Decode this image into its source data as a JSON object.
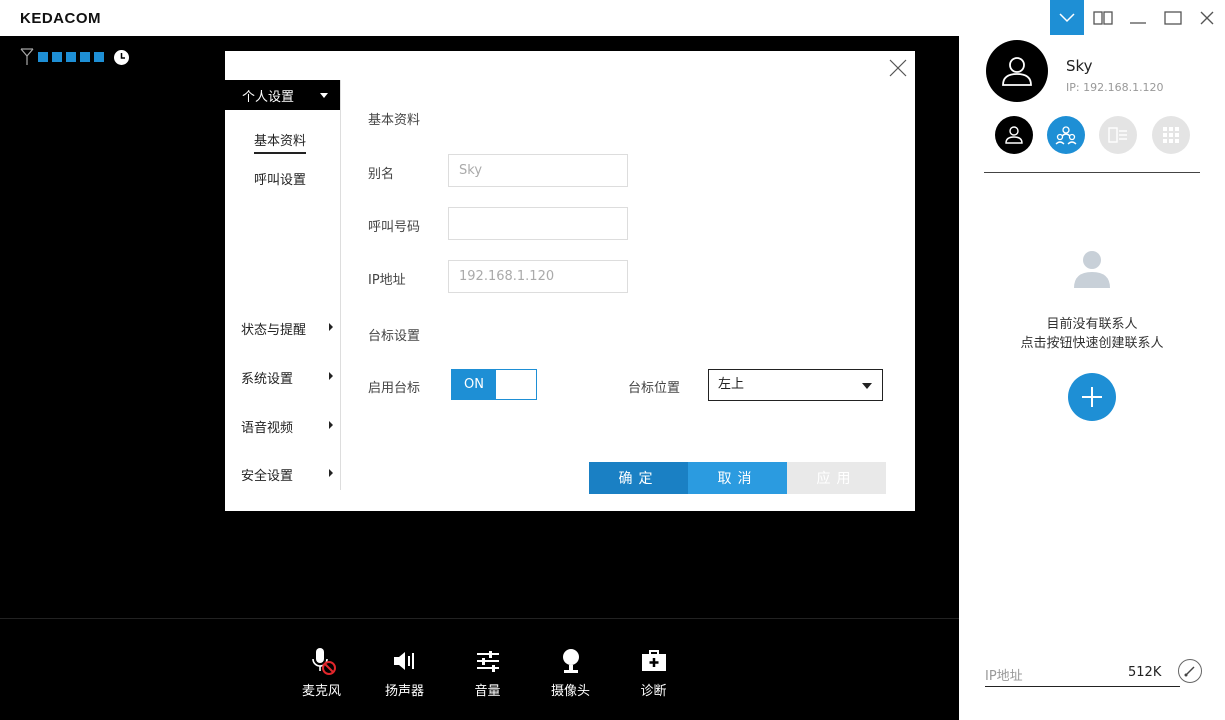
{
  "app": {
    "logo": "KEDACOM"
  },
  "colors": {
    "accent": "#1e8fd5",
    "video_bg": "#000000"
  },
  "window_buttons": [
    {
      "name": "dropdown-icon",
      "active": true
    },
    {
      "name": "split-view-icon"
    },
    {
      "name": "minimize-icon"
    },
    {
      "name": "maximize-icon"
    },
    {
      "name": "close-icon"
    }
  ],
  "status": {
    "signal_bars": 5,
    "icons": [
      "antenna-icon",
      "clock-icon"
    ]
  },
  "toolbar": [
    {
      "label": "麦克风",
      "icon": "mic-muted-icon"
    },
    {
      "label": "扬声器",
      "icon": "speaker-icon"
    },
    {
      "label": "音量",
      "icon": "volume-sliders-icon"
    },
    {
      "label": "摄像头",
      "icon": "camera-icon"
    },
    {
      "label": "诊断",
      "icon": "diagnosis-icon"
    }
  ],
  "dialog": {
    "nav": {
      "header": "个人设置",
      "sub_items": [
        "基本资料",
        "呼叫设置"
      ],
      "items": [
        "状态与提醒",
        "系统设置",
        "语音视频",
        "安全设置"
      ]
    },
    "section_basic": "基本资料",
    "fields": {
      "alias": {
        "label": "别名",
        "value": "Sky"
      },
      "call_number": {
        "label": "呼叫号码",
        "value": ""
      },
      "ip": {
        "label": "IP地址",
        "value": "192.168.1.120"
      }
    },
    "section_logo": "台标设置",
    "enable_logo": {
      "label": "启用台标",
      "state": "ON"
    },
    "logo_position": {
      "label": "台标位置",
      "value": "左上"
    },
    "buttons": {
      "ok": "确定",
      "cancel": "取消",
      "apply": "应用"
    }
  },
  "side": {
    "user": {
      "name": "Sky",
      "ip": "IP: 192.168.1.120"
    },
    "tabs": [
      "person-icon",
      "group-icon",
      "contact-card-icon",
      "grid-apps-icon"
    ],
    "empty": {
      "line1": "目前没有联系人",
      "line2": "点击按钮快速创建联系人"
    },
    "bandwidth": {
      "label": "IP地址",
      "value": "512K"
    }
  }
}
